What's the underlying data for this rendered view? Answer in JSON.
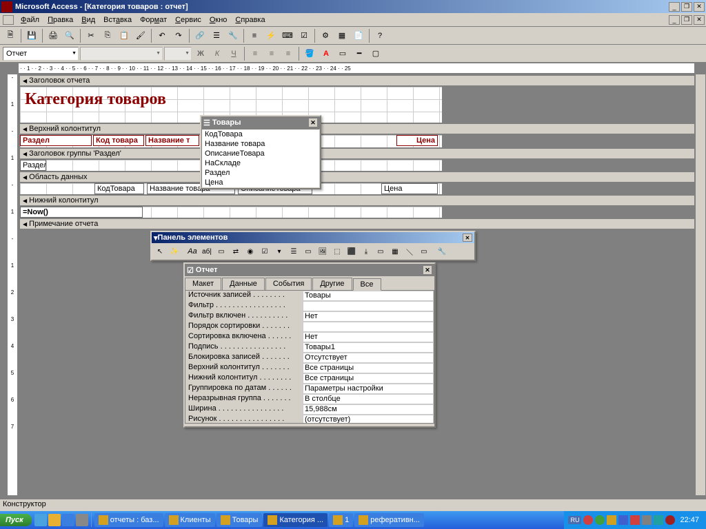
{
  "app": {
    "title": "Microsoft Access - [Категория товаров : отчет]"
  },
  "menu": {
    "file": "Файл",
    "edit": "Правка",
    "view": "Вид",
    "insert": "Вставка",
    "format": "Формат",
    "service": "Сервис",
    "window": "Окно",
    "help": "Справка"
  },
  "object_selector": "Отчет",
  "report": {
    "sections": {
      "report_header": "Заголовок отчета",
      "page_header": "Верхний колонтитул",
      "group_header": "Заголовок группы 'Раздел'",
      "detail": "Область данных",
      "page_footer": "Нижний колонтитул",
      "report_footer": "Примечание отчета"
    },
    "title_label": "Категория товаров",
    "header_labels": {
      "section": "Раздел",
      "code": "Код товара",
      "name": "Название т",
      "price": "Цена"
    },
    "group_field": "Раздел",
    "detail_fields": {
      "code": "КодТовара",
      "name": "Название товара",
      "desc": "ОписаниеТовара",
      "price": "Цена"
    },
    "now_expr": "=Now()"
  },
  "fieldlist": {
    "title": "Товары",
    "items": [
      "КодТовара",
      "Название товара",
      "ОписаниеТовара",
      "НаСкладе",
      "Раздел",
      "Цена"
    ]
  },
  "toolbox": {
    "title": "Панель элементов"
  },
  "props": {
    "title": "Отчет",
    "tabs": [
      "Макет",
      "Данные",
      "События",
      "Другие",
      "Все"
    ],
    "active_tab": "Все",
    "rows": [
      {
        "label": "Источник записей . . . . . . . .",
        "value": "Товары"
      },
      {
        "label": "Фильтр . . . . . . . . . . . . . . . . .",
        "value": ""
      },
      {
        "label": "Фильтр включен . . . . . . . . . .",
        "value": "Нет"
      },
      {
        "label": "Порядок сортировки . . . . . . .",
        "value": ""
      },
      {
        "label": "Сортировка включена . . . . . .",
        "value": "Нет"
      },
      {
        "label": "Подпись . . . . . . . . . . . . . . . .",
        "value": "Товары1"
      },
      {
        "label": "Блокировка записей . . . . . . .",
        "value": "Отсутствует"
      },
      {
        "label": "Верхний колонтитул . . . . . . .",
        "value": "Все страницы"
      },
      {
        "label": "Нижний колонтитул . . . . . . . .",
        "value": "Все страницы"
      },
      {
        "label": "Группировка по датам . . . . . .",
        "value": "Параметры настройки"
      },
      {
        "label": "Неразрывная группа . . . . . . .",
        "value": "В столбце"
      },
      {
        "label": "Ширина . . . . . . . . . . . . . . . .",
        "value": "15,988см"
      },
      {
        "label": "Рисунок . . . . . . . . . . . . . . . .",
        "value": "(отсутствует)"
      }
    ]
  },
  "status": "Конструктор",
  "taskbar": {
    "start": "Пуск",
    "tasks": [
      {
        "label": "отчеты : баз...",
        "active": false
      },
      {
        "label": "Клиенты",
        "active": false
      },
      {
        "label": "Товары",
        "active": false
      },
      {
        "label": "Категория ...",
        "active": true
      },
      {
        "label": "1",
        "active": false
      },
      {
        "label": "реферативн...",
        "active": false
      }
    ],
    "lang": "RU",
    "clock": "22:47"
  }
}
